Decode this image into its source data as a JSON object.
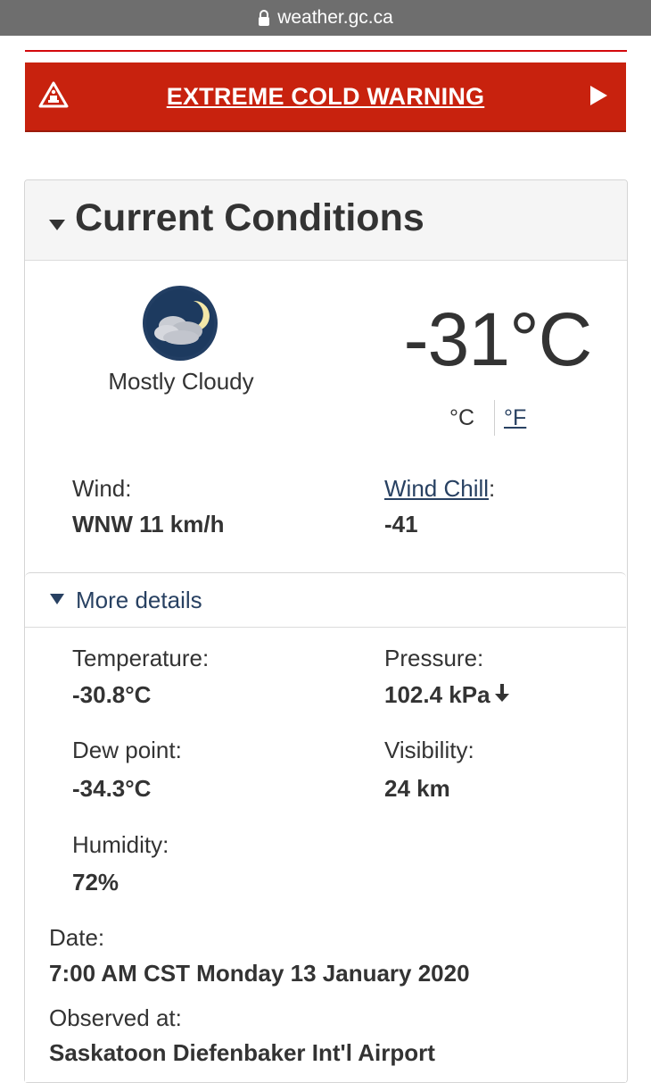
{
  "browser": {
    "url": "weather.gc.ca"
  },
  "alert": {
    "label": "EXTREME COLD WARNING"
  },
  "section": {
    "title": "Current Conditions"
  },
  "current": {
    "condition": "Mostly Cloudy",
    "temperature": "-31°C",
    "unit_c": "°C",
    "unit_f": "°F",
    "wind_label": "Wind:",
    "wind_value": "WNW 11 km/h",
    "windchill_link": "Wind Chill",
    "windchill_colon": ":",
    "windchill_value": "-41"
  },
  "details": {
    "toggle_label": "More details",
    "temperature_label": "Temperature:",
    "temperature_value": "-30.8°C",
    "pressure_label": "Pressure:",
    "pressure_value": "102.4 kPa",
    "dewpoint_label": "Dew point:",
    "dewpoint_value": "-34.3°C",
    "visibility_label": "Visibility:",
    "visibility_value": "24 km",
    "humidity_label": "Humidity:",
    "humidity_value": "72%",
    "date_label": "Date:",
    "date_value": "7:00 AM CST Monday 13 January 2020",
    "observed_label": "Observed at:",
    "observed_value": "Saskatoon Diefenbaker Int'l Airport"
  },
  "icons": {
    "lock": "lock-icon",
    "warning": "warning-triangle-icon",
    "arrow": "play-arrow-icon",
    "weather": "mostly-cloudy-night-icon",
    "pressure_trend": "arrow-down-icon"
  },
  "colors": {
    "alert_red": "#c8220e",
    "link_blue": "#284162",
    "urlbar_gray": "#6e6e6e"
  }
}
